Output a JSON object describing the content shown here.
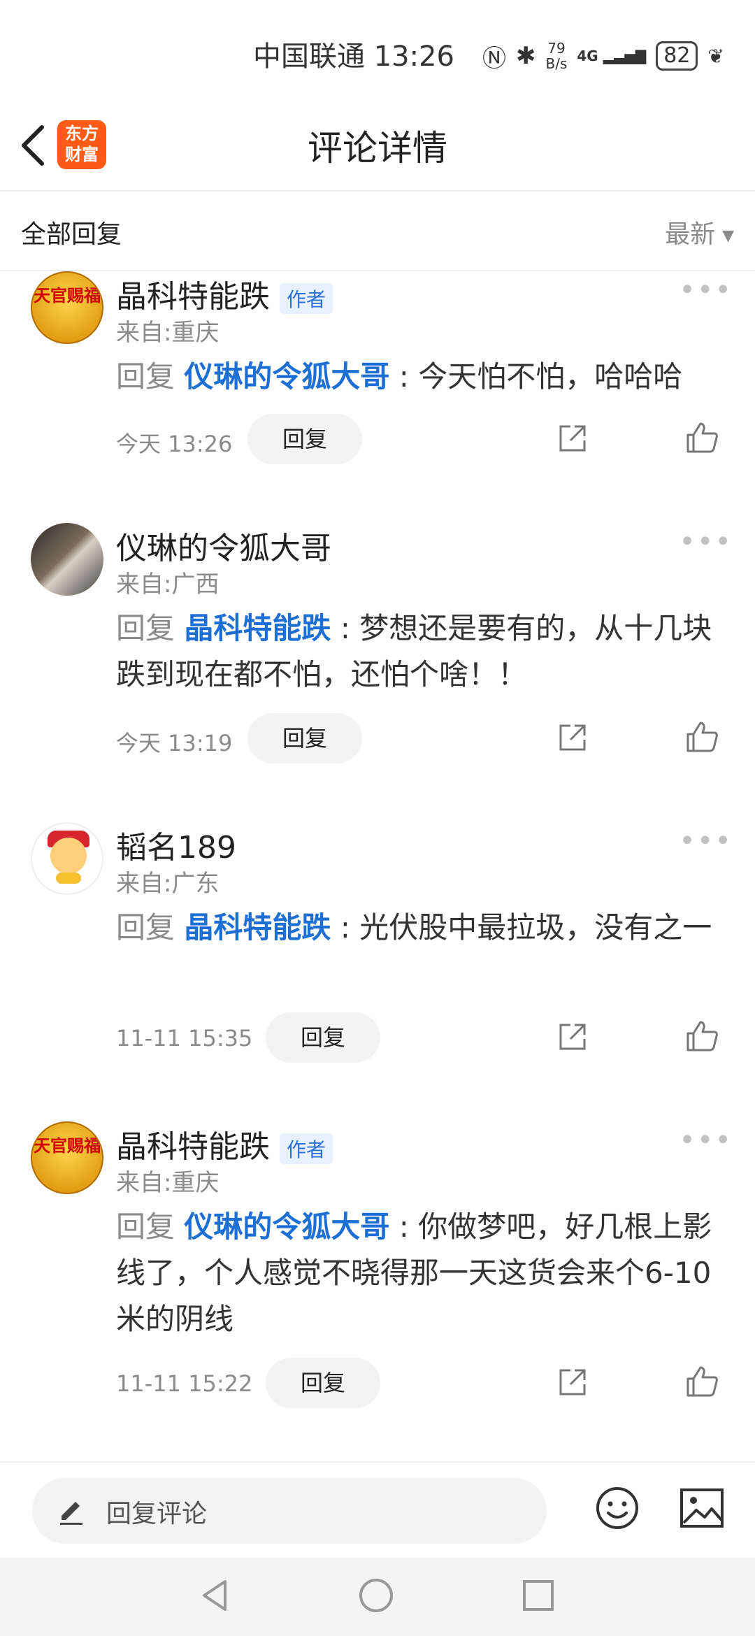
{
  "status_bar": {
    "carrier_time": "中国联通 13:26",
    "net_speed_value": "79",
    "net_speed_unit": "B/s",
    "network": "4G",
    "battery": "82"
  },
  "header": {
    "title": "评论详情",
    "logo_line1": "东方",
    "logo_line2": "财富"
  },
  "filter": {
    "left": "全部回复",
    "sort": "最新"
  },
  "comments": [
    {
      "name": "晶科特能跌",
      "tag": "作者",
      "from": "来自:重庆",
      "prefix": "回复 ",
      "mention": "仪琳的令狐大哥",
      "text": " : 今天怕不怕，哈哈哈",
      "time": "今天 13:26",
      "reply": "回复",
      "avatar_text": "天官赐福"
    },
    {
      "name": "仪琳的令狐大哥",
      "tag": "",
      "from": "来自:广西",
      "prefix": "回复 ",
      "mention": "晶科特能跌",
      "text": " : 梦想还是要有的，从十几块跌到现在都不怕，还怕个啥！！",
      "time": "今天 13:19",
      "reply": "回复"
    },
    {
      "name": "韬名189",
      "tag": "",
      "from": "来自:广东",
      "prefix": "回复 ",
      "mention": "晶科特能跌",
      "text": " : 光伏股中最拉圾，没有之一",
      "time": "11-11 15:35",
      "reply": "回复"
    },
    {
      "name": "晶科特能跌",
      "tag": "作者",
      "from": "来自:重庆",
      "prefix": "回复 ",
      "mention": "仪琳的令狐大哥",
      "text": " : 你做梦吧，好几根上影线了，个人感觉不晓得那一天这货会来个6-10米的阴线",
      "time": "11-11 15:22",
      "reply": "回复",
      "avatar_text": "天官赐福"
    }
  ],
  "input": {
    "placeholder": "回复评论"
  }
}
